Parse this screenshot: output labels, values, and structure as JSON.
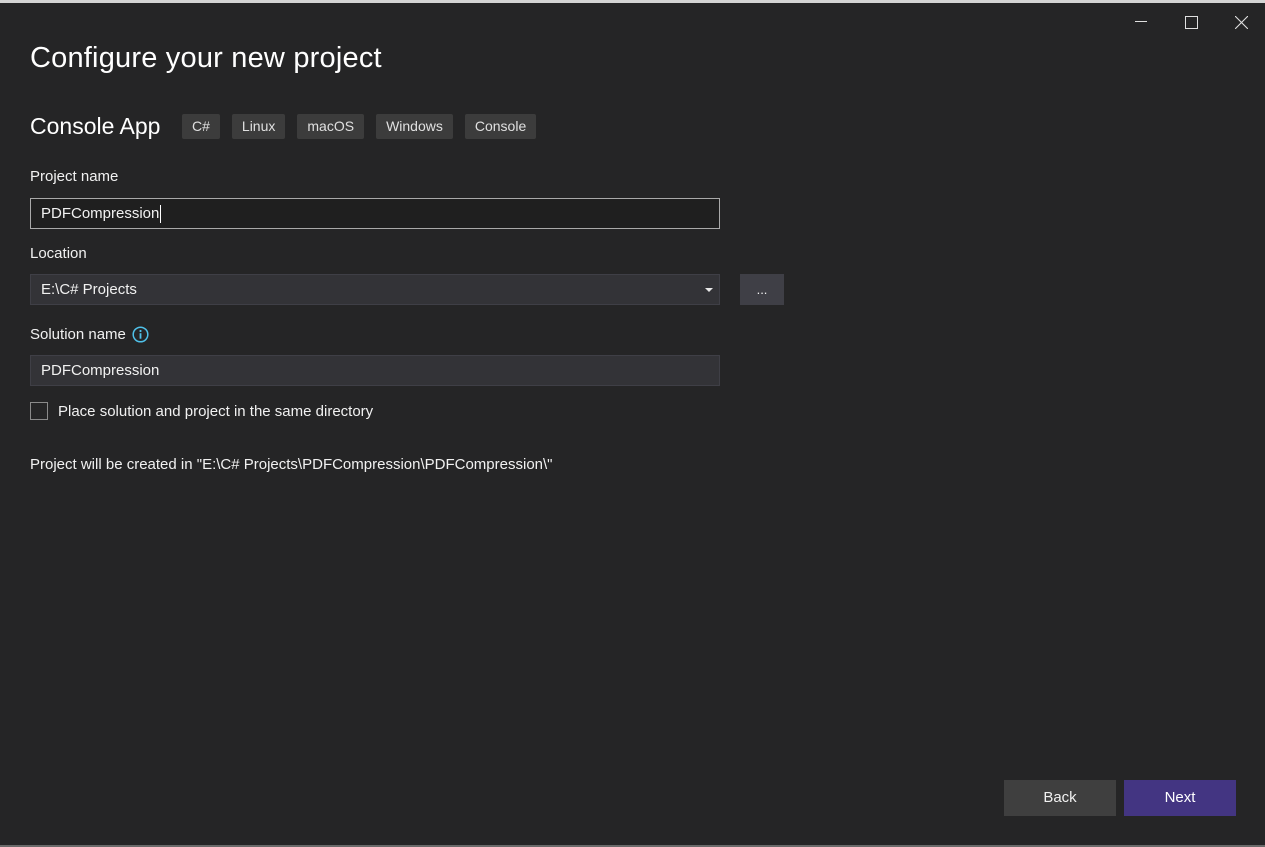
{
  "window": {
    "controls": {
      "minimize_icon": "minimize-icon",
      "maximize_icon": "maximize-icon",
      "close_icon": "close-icon"
    }
  },
  "header": {
    "title": "Configure your new project",
    "template_name": "Console App",
    "tags": [
      "C#",
      "Linux",
      "macOS",
      "Windows",
      "Console"
    ]
  },
  "form": {
    "project_name": {
      "label": "Project name",
      "value": "PDFCompression"
    },
    "location": {
      "label": "Location",
      "value": "E:\\C# Projects",
      "browse_label": "..."
    },
    "solution_name": {
      "label": "Solution name",
      "value": "PDFCompression",
      "info_icon": "info-icon"
    },
    "same_directory": {
      "label": "Place solution and project in the same directory",
      "checked": false
    },
    "path_info": "Project will be created in \"E:\\C# Projects\\PDFCompression\\PDFCompression\\\""
  },
  "footer": {
    "back_label": "Back",
    "next_label": "Next"
  },
  "colors": {
    "background": "#252526",
    "accent": "#433582",
    "info": "#4fc1e9"
  }
}
